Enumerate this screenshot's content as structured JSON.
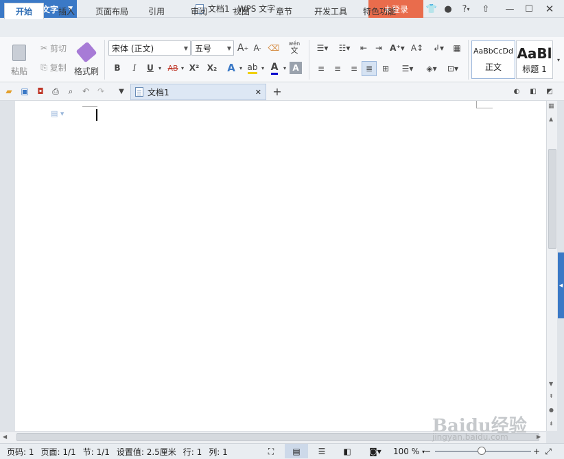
{
  "titlebar": {
    "app_name": "WPS 文字",
    "doc_title": "文档1 - WPS 文字",
    "login_label": "未登录",
    "help_label": "?"
  },
  "tabs": [
    {
      "label": "开始",
      "active": true
    },
    {
      "label": "插入"
    },
    {
      "label": "页面布局"
    },
    {
      "label": "引用"
    },
    {
      "label": "审阅"
    },
    {
      "label": "视图"
    },
    {
      "label": "章节"
    },
    {
      "label": "开发工具"
    },
    {
      "label": "特色功能"
    }
  ],
  "ribbon": {
    "paste_label": "粘贴",
    "cut_label": "剪切",
    "copy_label": "复制",
    "format_painter_label": "格式刷",
    "font_name": "宋体 (正文)",
    "font_size": "五号",
    "style_normal_preview": "AaBbCcDd",
    "style_normal_label": "正文",
    "style_heading_preview": "AaBl",
    "style_heading_label": "标题 1",
    "bold": "B",
    "italic": "I",
    "underline": "U",
    "strike": "AB",
    "superscript": "X²",
    "subscript": "X₂",
    "wen": "wén",
    "wen_char": "文"
  },
  "quickbar": {
    "doc_tab_label": "文档1"
  },
  "statusbar": {
    "page_num": "页码: 1",
    "pages": "页面: 1/1",
    "section": "节: 1/1",
    "setting": "设置值: 2.5厘米",
    "row": "行: 1",
    "col": "列: 1",
    "zoom": "100 %"
  },
  "watermark": {
    "text": "Baidu经验",
    "url": "jingyan.baidu.com"
  },
  "colors": {
    "accent": "#3b79c6",
    "login": "#e96c4c",
    "highlight": "#f0d000",
    "font_color": "#0000cc"
  }
}
